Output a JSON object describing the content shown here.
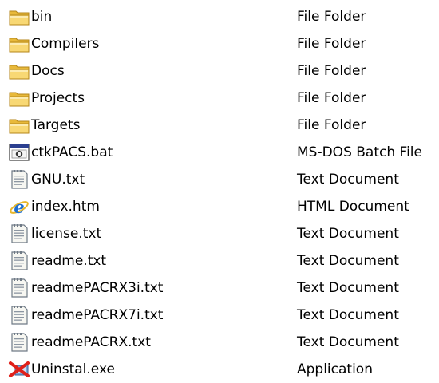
{
  "file_list": {
    "items": [
      {
        "name": "bin",
        "type": "File Folder",
        "icon": "folder-icon"
      },
      {
        "name": "Compilers",
        "type": "File Folder",
        "icon": "folder-icon"
      },
      {
        "name": "Docs",
        "type": "File Folder",
        "icon": "folder-icon"
      },
      {
        "name": "Projects",
        "type": "File Folder",
        "icon": "folder-icon"
      },
      {
        "name": "Targets",
        "type": "File Folder",
        "icon": "folder-icon"
      },
      {
        "name": "ctkPACS.bat",
        "type": "MS-DOS Batch File",
        "icon": "batch-file-icon"
      },
      {
        "name": "GNU.txt",
        "type": "Text Document",
        "icon": "text-document-icon"
      },
      {
        "name": "index.htm",
        "type": "HTML Document",
        "icon": "html-document-icon"
      },
      {
        "name": "license.txt",
        "type": "Text Document",
        "icon": "text-document-icon"
      },
      {
        "name": "readme.txt",
        "type": "Text Document",
        "icon": "text-document-icon"
      },
      {
        "name": "readmePACRX3i.txt",
        "type": "Text Document",
        "icon": "text-document-icon"
      },
      {
        "name": "readmePACRX7i.txt",
        "type": "Text Document",
        "icon": "text-document-icon"
      },
      {
        "name": "readmePACRX.txt",
        "type": "Text Document",
        "icon": "text-document-icon"
      },
      {
        "name": "Uninstal.exe",
        "type": "Application",
        "icon": "uninstall-application-icon"
      }
    ]
  },
  "colors": {
    "background": "#ffffff",
    "text": "#000000",
    "folder": "#f5d36b",
    "folder_edge": "#c89a1c",
    "uninstall_x": "#e0201a"
  }
}
